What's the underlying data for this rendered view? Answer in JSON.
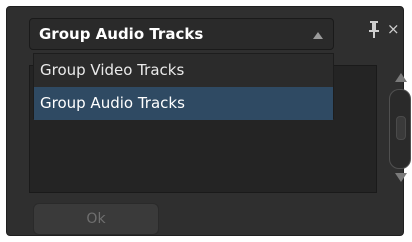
{
  "combo": {
    "selected": "Group Audio Tracks"
  },
  "dropdown": {
    "options": [
      {
        "label": "Group Video Tracks",
        "selected": false
      },
      {
        "label": "Group Audio Tracks",
        "selected": true
      }
    ]
  },
  "titlebar": {
    "close_glyph": "×"
  },
  "buttons": {
    "ok_label": "Ok"
  },
  "colors": {
    "panel_bg": "#2f2f2f",
    "selection_bg": "#2f4a63",
    "text": "#ffffff",
    "disabled_text": "#6f6f6f"
  },
  "icons": [
    "chevron-up-icon",
    "pin-icon",
    "close-icon",
    "scroll-up-arrow-icon",
    "scroll-down-arrow-icon"
  ]
}
